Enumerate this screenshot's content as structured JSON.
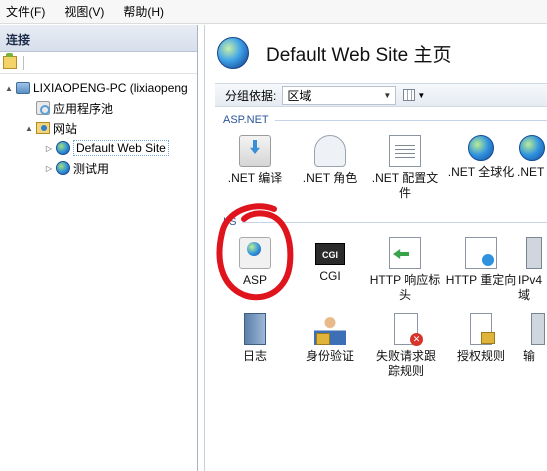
{
  "menu": [
    {
      "label": "文件(F)",
      "name": "menu-file"
    },
    {
      "label": "视图(V)",
      "name": "menu-view"
    },
    {
      "label": "帮助(H)",
      "name": "menu-help"
    }
  ],
  "connections": {
    "title": "连接",
    "tree": [
      {
        "label": "LIXIAOPENG-PC (lixiaopeng",
        "icon": "server-icon",
        "arrow": "▲",
        "level": 0
      },
      {
        "label": "应用程序池",
        "icon": "app-pool-icon",
        "arrow": "",
        "level": 1
      },
      {
        "label": "网站",
        "icon": "sites-folder-icon",
        "arrow": "▲",
        "level": 1
      },
      {
        "label": "Default Web Site",
        "icon": "globe-icon",
        "arrow": "▷",
        "level": 2,
        "selected": true
      },
      {
        "label": "测试用",
        "icon": "globe-icon",
        "arrow": "▷",
        "level": 2
      }
    ]
  },
  "main": {
    "title": "Default Web Site 主页",
    "group_by_label": "分组依据:",
    "group_by_value": "区域",
    "sections": [
      {
        "title": "ASP.NET",
        "items": [
          {
            "label": ".NET 编译",
            "icon": "net-compile-icon"
          },
          {
            "label": ".NET 角色",
            "icon": "net-roles-icon"
          },
          {
            "label": ".NET 配置文件",
            "icon": "net-profile-icon"
          },
          {
            "label": ".NET 全球化",
            "icon": "net-globalization-icon"
          },
          {
            "label": ".NET",
            "icon": "net-partial-icon"
          }
        ]
      },
      {
        "title": "IIS",
        "items": [
          {
            "label": "ASP",
            "icon": "asp-icon"
          },
          {
            "label": "CGI",
            "icon": "cgi-icon"
          },
          {
            "label": "HTTP 响应标头",
            "icon": "http-response-headers-icon"
          },
          {
            "label": "HTTP 重定向",
            "icon": "http-redirect-icon"
          },
          {
            "label": "IPv4 域",
            "icon": "ip-restrictions-icon"
          },
          {
            "label": "日志",
            "icon": "logging-icon"
          },
          {
            "label": "身份验证",
            "icon": "authentication-icon"
          },
          {
            "label": "失败请求跟踪规则",
            "icon": "failed-request-tracing-icon"
          },
          {
            "label": "授权规则",
            "icon": "authorization-rules-icon"
          },
          {
            "label": "输",
            "icon": "output-caching-icon"
          }
        ]
      }
    ],
    "annotation_color": "#e0141c"
  }
}
